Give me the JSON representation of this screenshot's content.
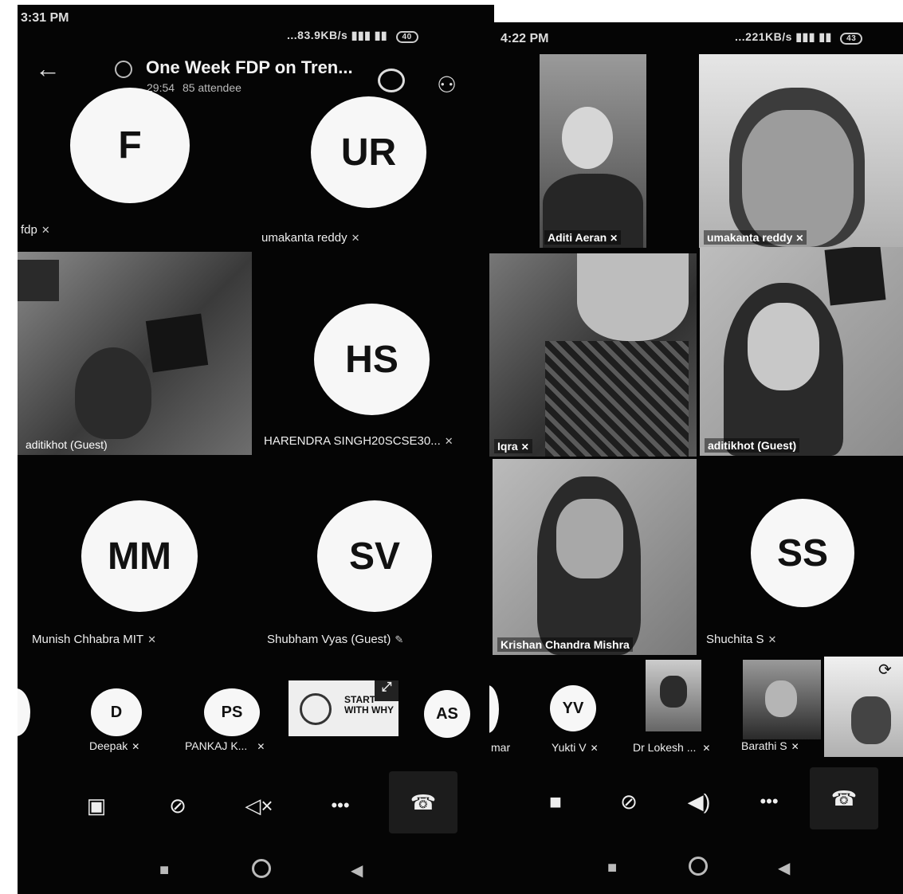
{
  "left": {
    "status": {
      "time": "3:31 PM",
      "network": "...83.9KB/s",
      "battery": "40"
    },
    "header": {
      "title": "One Week FDP on Tren...",
      "duration": "29:54",
      "attendees": "85 attendee"
    },
    "tiles": [
      {
        "initials": "F",
        "name": "fdp"
      },
      {
        "initials": "UR",
        "name": "umakanta reddy"
      },
      {
        "name": "aditikhot (Guest)"
      },
      {
        "initials": "HS",
        "name": "HARENDRA SINGH20SCSE30..."
      },
      {
        "initials": "MM",
        "name": "Munish Chhabra MIT"
      },
      {
        "initials": "SV",
        "name": "Shubham Vyas (Guest)"
      }
    ],
    "strip": [
      {
        "initials": "D",
        "name": "Deepak"
      },
      {
        "initials": "PS",
        "name": "PANKAJ K..."
      },
      {
        "initials": "AS"
      }
    ],
    "strip_thumb_text": "START WITH WHY"
  },
  "right": {
    "status": {
      "time": "4:22 PM",
      "network": "...221KB/s",
      "battery": "43"
    },
    "tiles": [
      {
        "name": "Aditi Aeran"
      },
      {
        "name": "umakanta reddy"
      },
      {
        "name": "Iqra"
      },
      {
        "name": "aditikhot (Guest)"
      },
      {
        "name": "Krishan Chandra Mishra"
      },
      {
        "initials": "SS",
        "name": "Shuchita S"
      }
    ],
    "strip": [
      {
        "name": "mar"
      },
      {
        "initials": "YV",
        "name": "Yukti V"
      },
      {
        "name": "Dr Lokesh ..."
      },
      {
        "name": "Barathi S"
      }
    ]
  },
  "icons": {
    "mute": "mic-off-icon",
    "back": "arrow-left-icon",
    "chat": "chat-icon",
    "people": "people-icon"
  }
}
